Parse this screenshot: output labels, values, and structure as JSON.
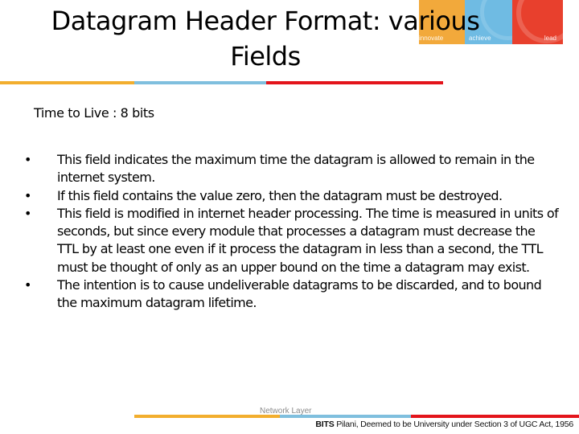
{
  "slide": {
    "title_line1": "Datagram Header Format: various",
    "title_line2": "Fields",
    "subtitle": "Time to Live : 8 bits",
    "bullet_symbol": "•",
    "bullets": [
      "This field  indicates  the maximum  time  the datagram  is allowed  to remain  in  the  internet system.",
      "If  this field contains the value zero, then the datagram must be destroyed.",
      "This field is modified in internet header processing. The time is measured in units of seconds, but since every module that processes a datagram must decrease the TTL by at least one even if it process the datagram in less than a second, the TTL must be thought of only as an upper bound on the time a datagram may exist.",
      "The intention is to cause undeliverable datagrams to be discarded, and to bound the maximum datagram lifetime."
    ]
  },
  "logo": {
    "labels": [
      "innovate",
      "achieve",
      "lead"
    ],
    "colors": [
      "#f2a93b",
      "#6fbbe3",
      "#e8402d"
    ]
  },
  "footer": {
    "section_label": "Network Layer",
    "institution_bold": "BITS",
    "institution_rest": " Pilani, Deemed to be University under Section 3 of UGC Act, 1956"
  },
  "theme": {
    "orange": "#f2ae2e",
    "blue": "#7fbfde",
    "red": "#e3141b"
  }
}
